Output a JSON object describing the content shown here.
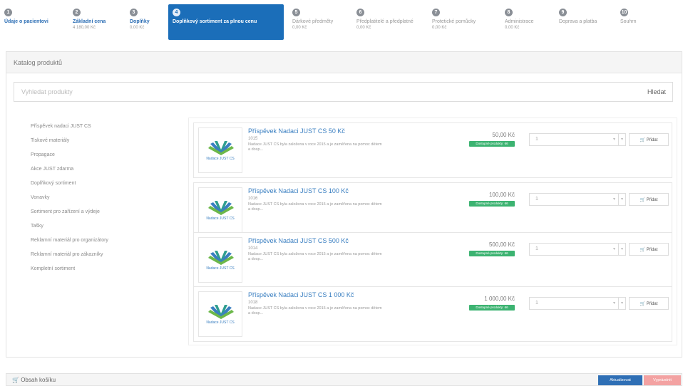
{
  "steps": [
    {
      "num": "1",
      "title": "Údaje o pacientovi",
      "price": ""
    },
    {
      "num": "2",
      "title": "Základní cena",
      "price": "4 180,00 Kč"
    },
    {
      "num": "3",
      "title": "Doplňky",
      "price": "0,00 Kč"
    },
    {
      "num": "4",
      "title": "Doplňkový sortiment za plnou cenu",
      "price": ""
    },
    {
      "num": "5",
      "title": "Dárkové předměty",
      "price": "0,00 Kč"
    },
    {
      "num": "6",
      "title": "Předplatitelé a předplatné",
      "price": "0,00 Kč"
    },
    {
      "num": "7",
      "title": "Protetické pomůcky",
      "price": "0,00 Kč"
    },
    {
      "num": "8",
      "title": "Administrace",
      "price": "0,00 Kč"
    },
    {
      "num": "9",
      "title": "Doprava a platba",
      "price": ""
    },
    {
      "num": "10",
      "title": "Souhrn",
      "price": ""
    }
  ],
  "catalog": {
    "title": "Katalog produktů",
    "search_placeholder": "Vyhledat produkty",
    "search_button": "Hledat"
  },
  "categories": [
    "Příspěvek nadaci JUST CS",
    "Tiskové materiály",
    "Propagace",
    "Akce JUST zdarma",
    "Doplňkový sortiment",
    "Vonavky",
    "Sortiment pro zařízení a výdeje",
    "Tašky",
    "Reklamní materiál pro organizátory",
    "Reklamní materiál pro zákazníky",
    "Kompletní sortiment"
  ],
  "products": [
    {
      "title": "Příspěvek Nadaci JUST CS 50 Kč",
      "code": "1015",
      "desc": "Nadace JUST CS byla založena v roce 2015 a je zaměřena na pomoc dětem a dosp...",
      "price": "50,00 Kč",
      "badge": "Dostupné produkty: 66",
      "qty": "1",
      "add": "Přidat"
    },
    {
      "title": "Příspěvek Nadaci JUST CS 100 Kč",
      "code": "1016",
      "desc": "Nadace JUST CS byla založena v roce 2015 a je zaměřena na pomoc dětem a dosp...",
      "price": "100,00 Kč",
      "badge": "Dostupné produkty: 66",
      "qty": "1",
      "add": "Přidat"
    },
    {
      "title": "Příspěvek Nadaci JUST CS 500 Kč",
      "code": "1014",
      "desc": "Nadace JUST CS byla založena v roce 2015 a je zaměřena na pomoc dětem a dosp...",
      "price": "500,00 Kč",
      "badge": "Dostupné produkty: 66",
      "qty": "1",
      "add": "Přidat"
    },
    {
      "title": "Příspěvek Nadaci JUST CS 1 000 Kč",
      "code": "1018",
      "desc": "Nadace JUST CS byla založena v roce 2015 a je zaměřena na pomoc dětem a dosp...",
      "price": "1 000,00 Kč",
      "badge": "Dostupné produkty: 66",
      "qty": "1",
      "add": "Přidat"
    }
  ],
  "logo_text": "Nadace JUST CS",
  "cart": {
    "title": "Obsah košíku",
    "update_button": "Aktualizovat",
    "empty_button": "Vyprázdnit"
  },
  "colors": {
    "accent": "#1b6eb9",
    "link": "#3a7fc1",
    "badge": "#3cb371",
    "danger": "#f3a2a2"
  }
}
